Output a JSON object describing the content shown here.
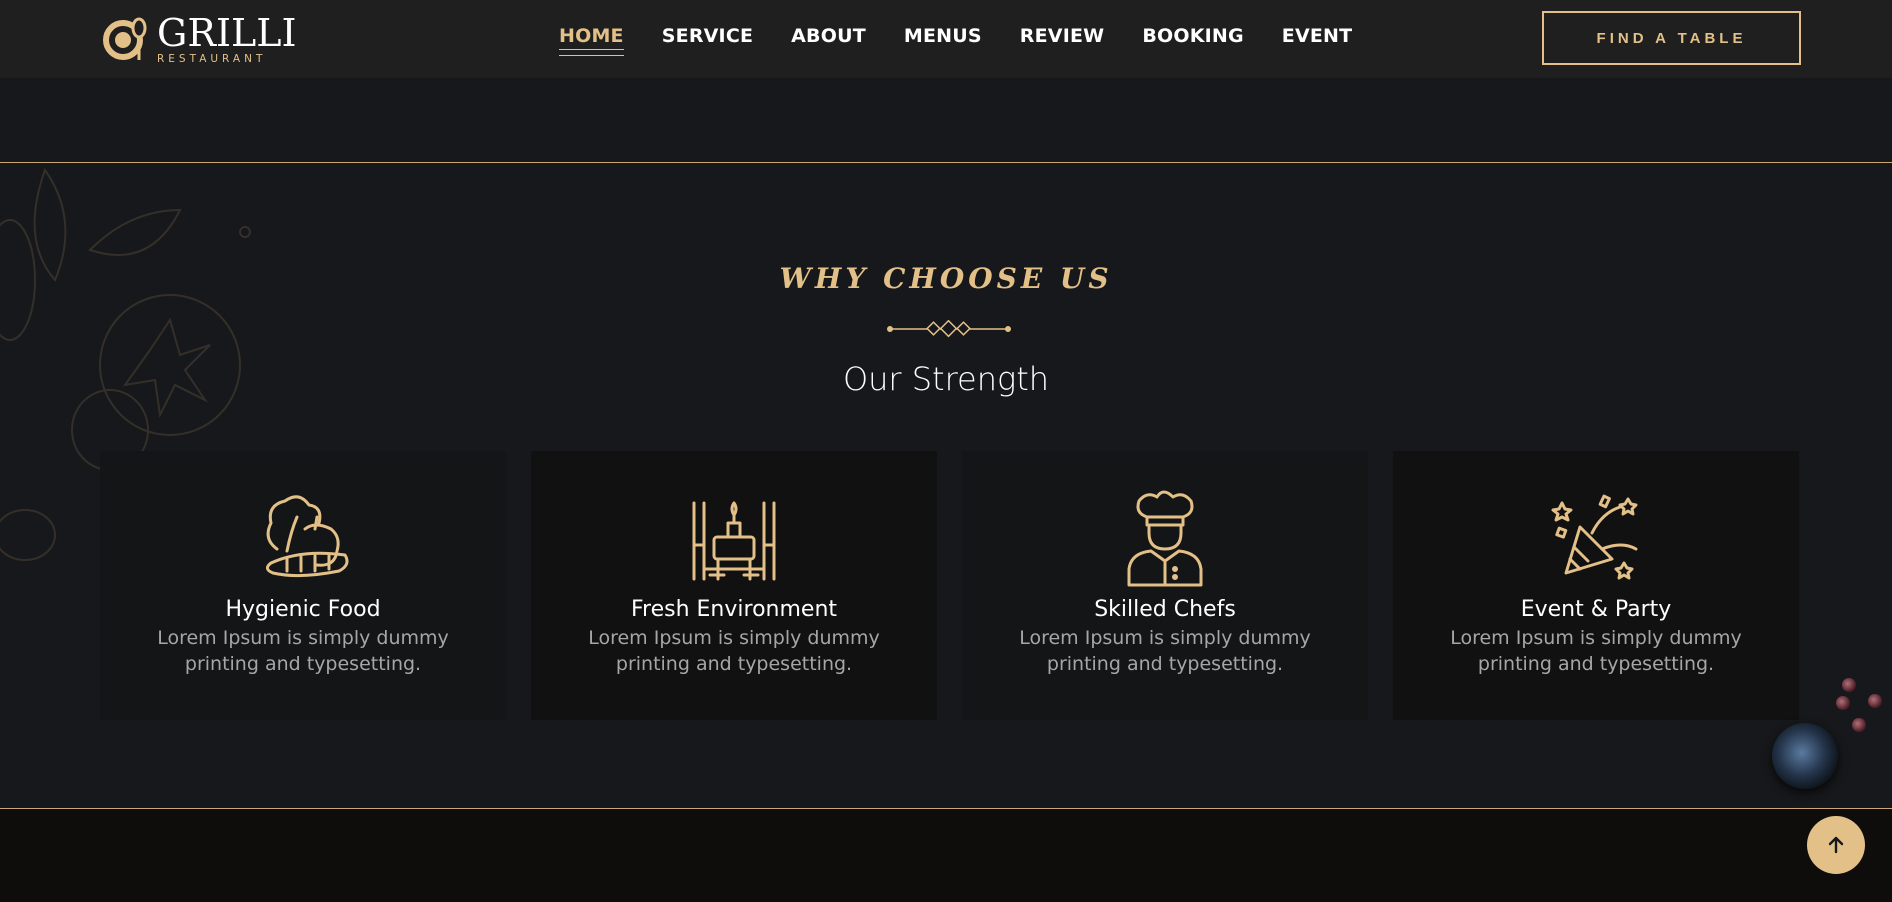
{
  "brand": {
    "title": "GRILLI",
    "subtitle": "RESTAURANT"
  },
  "nav": {
    "items": [
      {
        "label": "HOME",
        "active": true
      },
      {
        "label": "SERVICE"
      },
      {
        "label": "ABOUT"
      },
      {
        "label": "MENUS"
      },
      {
        "label": "REVIEW"
      },
      {
        "label": "BOOKING"
      },
      {
        "label": "EVENT"
      }
    ],
    "cta_label": "FIND A TABLE"
  },
  "section": {
    "kicker": "WHY CHOOSE US",
    "heading": "Our Strength",
    "cards": [
      {
        "icon": "vegetables-icon",
        "title": "Hygienic Food",
        "text": "Lorem Ipsum is simply dummy printing and typesetting."
      },
      {
        "icon": "dining-table-icon",
        "title": "Fresh Environment",
        "text": "Lorem Ipsum is simply dummy printing and typesetting."
      },
      {
        "icon": "chef-icon",
        "title": "Skilled Chefs",
        "text": "Lorem Ipsum is simply dummy printing and typesetting."
      },
      {
        "icon": "party-popper-icon",
        "title": "Event & Party",
        "text": "Lorem Ipsum is simply dummy printing and typesetting."
      }
    ]
  },
  "colors": {
    "accent": "#e3c088",
    "background": "#16181b",
    "header": "#1f1f20"
  },
  "icons": {
    "scroll_top": "arrow-up-icon"
  }
}
